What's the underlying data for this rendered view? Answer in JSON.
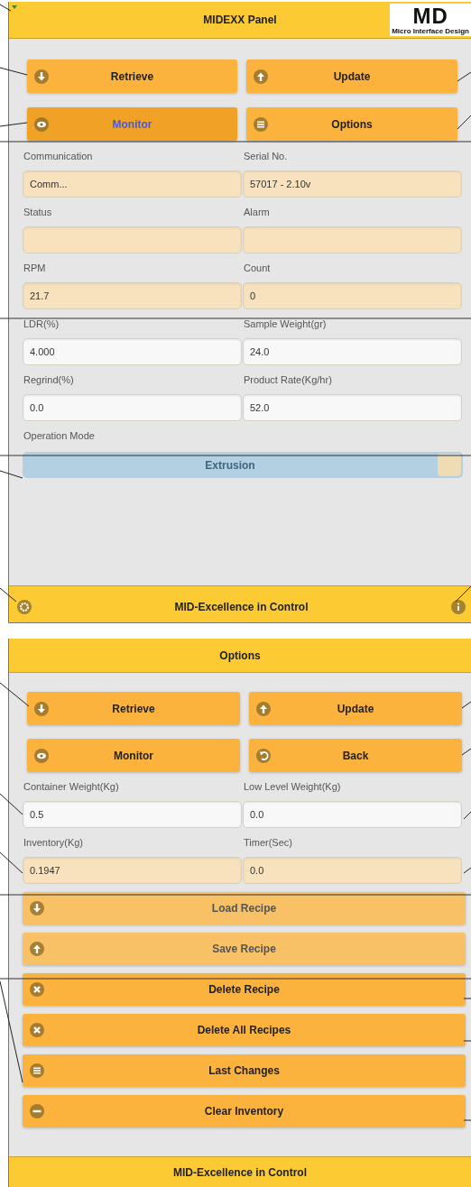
{
  "monitor_panel": {
    "header": {
      "title": "MIDEXX Panel",
      "logo": {
        "mark": "MD",
        "tagline": "Micro Interface Design"
      }
    },
    "nav_buttons": [
      {
        "label": "Retrieve",
        "selected": false
      },
      {
        "label": "Update",
        "selected": false
      },
      {
        "label": "Monitor",
        "selected": true
      },
      {
        "label": "Options",
        "selected": false
      }
    ],
    "fields": [
      {
        "label": "Communication",
        "value": "Comm...",
        "readonly": true
      },
      {
        "label": "Serial No.",
        "value": "57017 - 2.10v",
        "readonly": true
      },
      {
        "label": "Status",
        "readonly": true
      },
      {
        "label": "Alarm",
        "readonly": true
      },
      {
        "label": "RPM",
        "value": "21.7",
        "readonly": true
      },
      {
        "label": "Count",
        "value": "0",
        "readonly": true
      },
      {
        "label": "LDR(%)",
        "value": "4.000",
        "readonly": false
      },
      {
        "label": "Sample Weight(gr)",
        "value": "24.0",
        "readonly": false
      },
      {
        "label": "Regrind(%)",
        "value": "0.0",
        "readonly": false
      },
      {
        "label": "Product Rate(Kg/hr)",
        "value": "52.0",
        "readonly": false
      }
    ],
    "operation_mode": {
      "label": "Operation Mode",
      "switch": {
        "label": "Extrusion",
        "on": false
      }
    },
    "footer": {
      "title": "MID-Excellence in Control"
    }
  },
  "options_panel": {
    "header": {
      "title": "Options"
    },
    "nav_buttons": [
      {
        "label": "Retrieve"
      },
      {
        "label": "Update"
      },
      {
        "label": "Monitor"
      },
      {
        "label": "Back"
      }
    ],
    "fields": [
      {
        "label": "Container Weight(Kg)",
        "value": "0.5",
        "readonly": false
      },
      {
        "label": "Low Level Weight(Kg)",
        "value": "0.0",
        "readonly": false
      },
      {
        "label": "Inventory(Kg)",
        "value": "0.1947",
        "readonly": true
      },
      {
        "label": "Timer(Sec)",
        "value": "0.0",
        "readonly": true
      }
    ],
    "recipe_buttons": [
      {
        "label": "Load Recipe",
        "disabled": true
      },
      {
        "label": "Save Recipe",
        "disabled": true
      },
      {
        "label": "Delete Recipe",
        "disabled": false
      },
      {
        "label": "Delete All Recipes",
        "disabled": false
      },
      {
        "label": "Last Changes",
        "disabled": false
      },
      {
        "label": "Clear Inventory",
        "disabled": false
      }
    ],
    "footer": {
      "title": "MID-Excellence in Control"
    }
  }
}
